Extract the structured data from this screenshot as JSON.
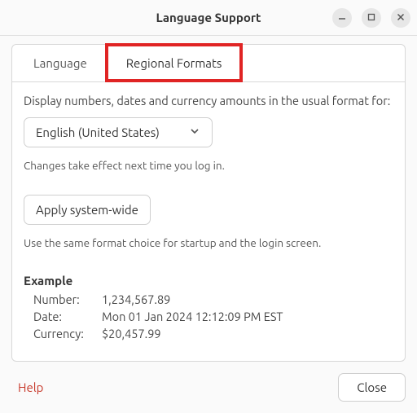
{
  "window": {
    "title": "Language Support"
  },
  "tabs": {
    "language": "Language",
    "regional": "Regional Formats"
  },
  "panel": {
    "prompt": "Display numbers, dates and currency amounts in the usual format for:",
    "locale_selected": "English (United States)",
    "login_note": "Changes take effect next time you log in.",
    "apply_button": "Apply system-wide",
    "apply_note": "Use the same format choice for startup and the login screen."
  },
  "example": {
    "heading": "Example",
    "number_label": "Number:",
    "number_value": "1,234,567.89",
    "date_label": "Date:",
    "date_value": "Mon 01 Jan 2024 12:12:09 PM EST",
    "currency_label": "Currency:",
    "currency_value": "$20,457.99"
  },
  "footer": {
    "help": "Help",
    "close": "Close"
  }
}
